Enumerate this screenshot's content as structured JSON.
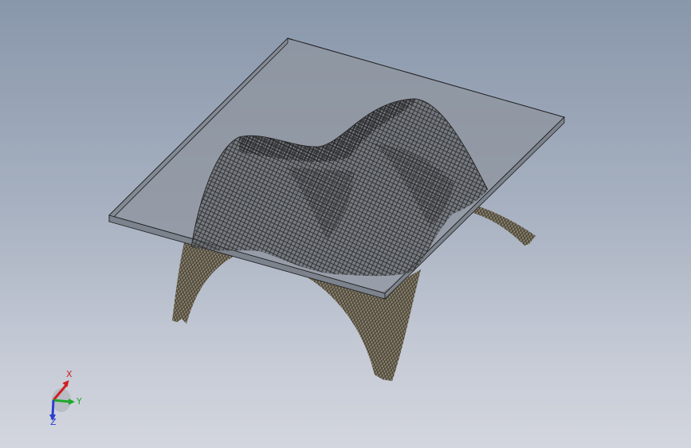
{
  "viewport": {
    "background_top": "#8997ab",
    "background_bottom": "#d3d6de"
  },
  "model": {
    "plate_fill": "#8e959f",
    "plate_edge": "#1e1e1e",
    "mesh_color": "#2a2a2a",
    "underside_fill": "#8a8270"
  },
  "triad": {
    "x_label": "X",
    "y_label": "Y",
    "z_label": "Z",
    "x_color": "#d01f1f",
    "y_color": "#1fa82a",
    "z_color": "#2a3fd0"
  }
}
